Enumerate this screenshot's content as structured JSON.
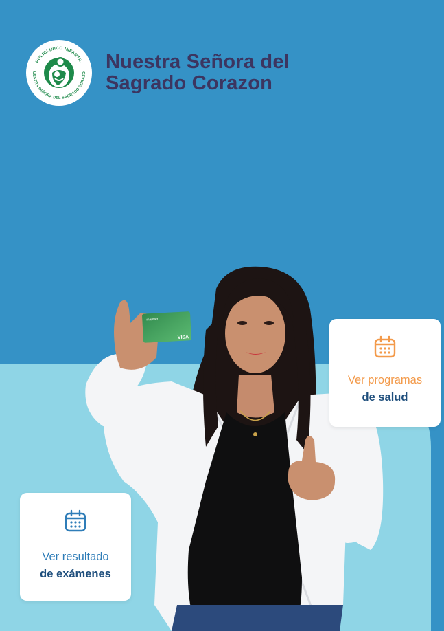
{
  "brand": {
    "logo_ring_text_top": "POLICLINICO INFANTIL",
    "logo_ring_text_bottom": "NUESTRA SEÑORA DEL SAGRADO CORAZON",
    "name_line1": "Nuestra Señora del",
    "name_line2": "Sagrado Corazon"
  },
  "cards": {
    "programs": {
      "line1": "Ver programas",
      "line2": "de salud",
      "icon": "calendar-icon",
      "icon_color": "#f39a4a"
    },
    "results": {
      "line1": "Ver resultado",
      "line2": "de exámenes",
      "icon": "calendar-icon",
      "icon_color": "#2f7db8"
    }
  },
  "card_in_hand": {
    "brand": "mamatt",
    "network": "VISA"
  },
  "colors": {
    "background": "#3592c6",
    "light_panel": "#8fd5e6",
    "title": "#3c3560",
    "logo_green": "#1e8a4a"
  }
}
